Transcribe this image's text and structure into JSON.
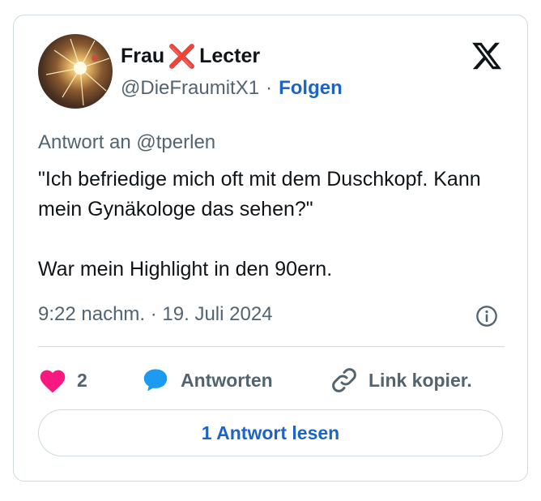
{
  "author": {
    "name_part1": "Frau",
    "name_mark": "❌",
    "name_part2": "Lecter",
    "handle": "@DieFraumitX1",
    "separator": "·",
    "follow_label": "Folgen"
  },
  "post": {
    "reply_to": "Antwort an @tperlen",
    "text": "\"Ich befriedige mich oft mit dem Duschkopf. Kann mein Gynäkologe das sehen?\"\n\nWar mein Highlight in den 90ern.",
    "timestamp": "9:22 nachm. · 19. Juli 2024"
  },
  "actions": {
    "like_count": "2",
    "reply_label": "Antworten",
    "copy_link_label": "Link kopier."
  },
  "read_replies_label": "1 Antwort lesen",
  "colors": {
    "like": "#f91880",
    "reply": "#1d9bf0",
    "link_blue": "#1d64c8",
    "muted": "#536471"
  },
  "icons": [
    "avatar",
    "x-logo-icon",
    "info-icon",
    "heart-icon",
    "reply-bubble-icon",
    "link-icon"
  ]
}
